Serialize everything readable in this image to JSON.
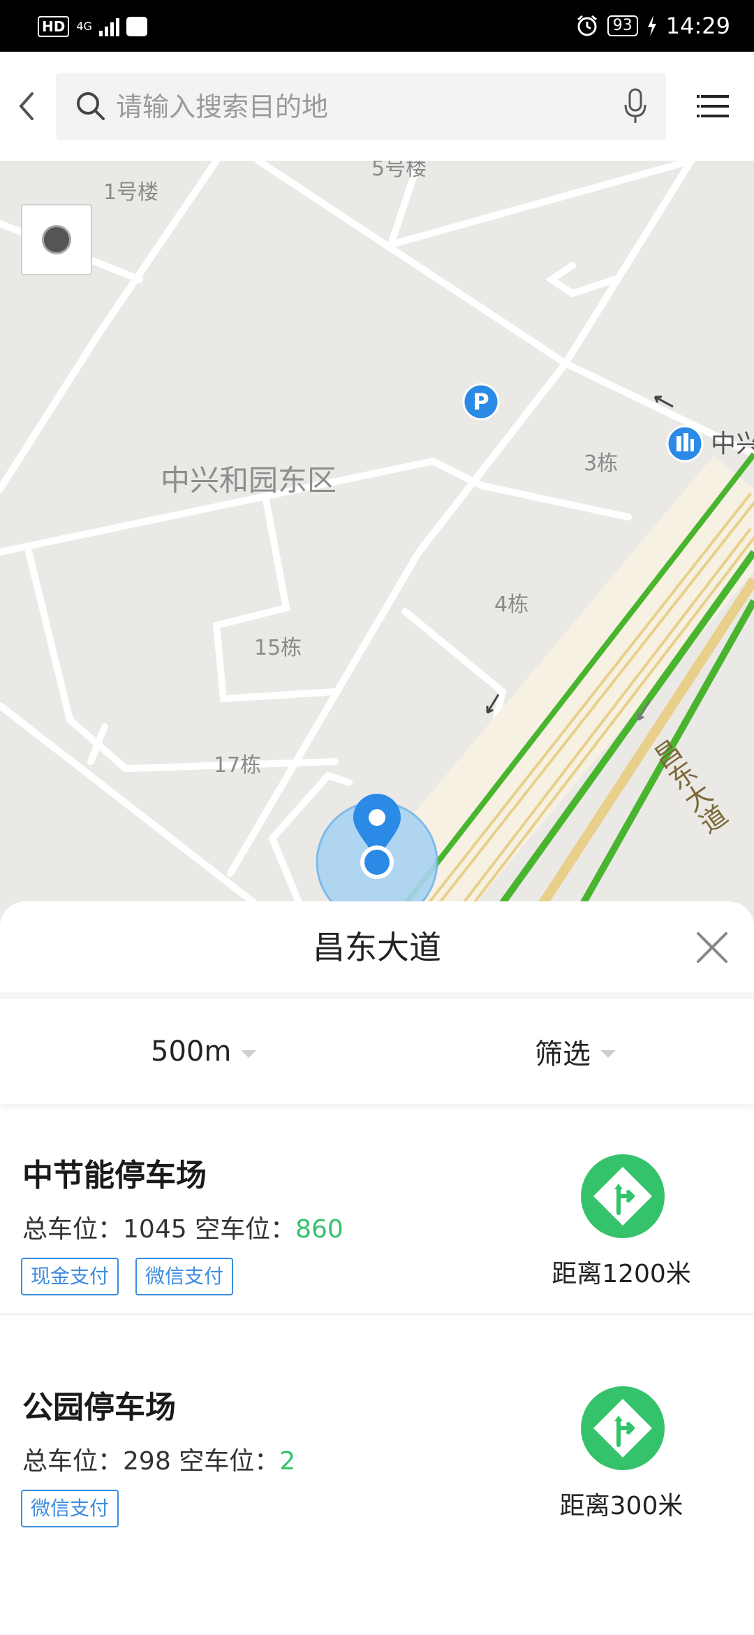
{
  "status_bar": {
    "hd": "HD",
    "network": "4G",
    "battery": "93",
    "time": "14:29"
  },
  "header": {
    "search_placeholder": "请输入搜索目的地"
  },
  "map": {
    "labels": {
      "building_1": "1号楼",
      "building_5": "5号楼",
      "district": "中兴和园东区",
      "building_3": "3栋",
      "building_4": "4栋",
      "building_15": "15栋",
      "building_17": "17栋",
      "road": "昌东大道",
      "poi_partial": "中兴"
    }
  },
  "sheet": {
    "title": "昌东大道",
    "filters": {
      "distance": "500m",
      "filter": "筛选"
    },
    "lots": [
      {
        "name": "中节能停车场",
        "total_label": "总车位：",
        "total": "1045",
        "free_label": "空车位：",
        "free": "860",
        "tags": [
          "现金支付",
          "微信支付"
        ],
        "distance": "距离1200米"
      },
      {
        "name": "公园停车场",
        "total_label": "总车位：",
        "total": "298",
        "free_label": "空车位：",
        "free": "2",
        "tags": [
          "微信支付"
        ],
        "distance": "距离300米"
      }
    ]
  },
  "colors": {
    "accent_green": "#34c26a",
    "tag_blue": "#3d8de0",
    "location_blue": "#2a8ae6"
  }
}
